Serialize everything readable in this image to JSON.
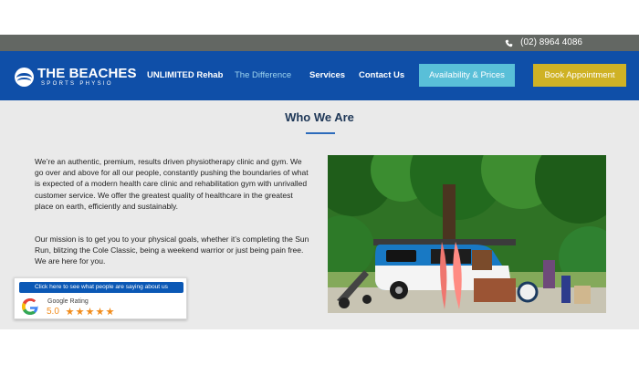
{
  "topbar": {
    "phone": "(02) 8964 4086",
    "phone_icon": "phone-icon",
    "background": "#636763"
  },
  "header": {
    "logo_title": "THE BEACHES",
    "logo_subtitle": "SPORTS PHYSIO",
    "nav_items": [
      {
        "label": "UNLIMITED Rehab"
      },
      {
        "label": "The Difference",
        "active": true
      },
      {
        "label": "Services"
      },
      {
        "label": "Contact Us"
      }
    ],
    "buttons": {
      "availability": "Availability & Prices",
      "book": "Book Appointment"
    },
    "colors": {
      "nav_background": "#0f4fa8",
      "availability_button": "#59bfd8",
      "book_button": "#cfb225",
      "active_nav": "#9ed5ef"
    }
  },
  "main": {
    "title": "Who We Are",
    "paragraphs": [
      "We’re an authentic, premium, results driven physiotherapy clinic and gym. We go over and above for all our people, constantly pushing the boundaries of what is expected of a modern health care clinic and rehabilitation gym with unrivalled customer service. We offer the greatest quality of healthcare in the greatest place on earth, efficiently and sustainably.",
      "Our mission is to get you to your physical goals, whether it’s completing the Sun Run, blitzing the Cole Classic, being a weekend warrior or just being pain free. We are here for you."
    ],
    "image": {
      "name": "kombi-van-surfboards-photo"
    }
  },
  "rating_widget": {
    "banner": "Click here to see what people are saying about us",
    "label": "Google Rating",
    "score": "5.0",
    "stars": 5,
    "icon": "google-g-icon",
    "banner_color": "#0b58b5",
    "star_color": "#f28c1b"
  }
}
